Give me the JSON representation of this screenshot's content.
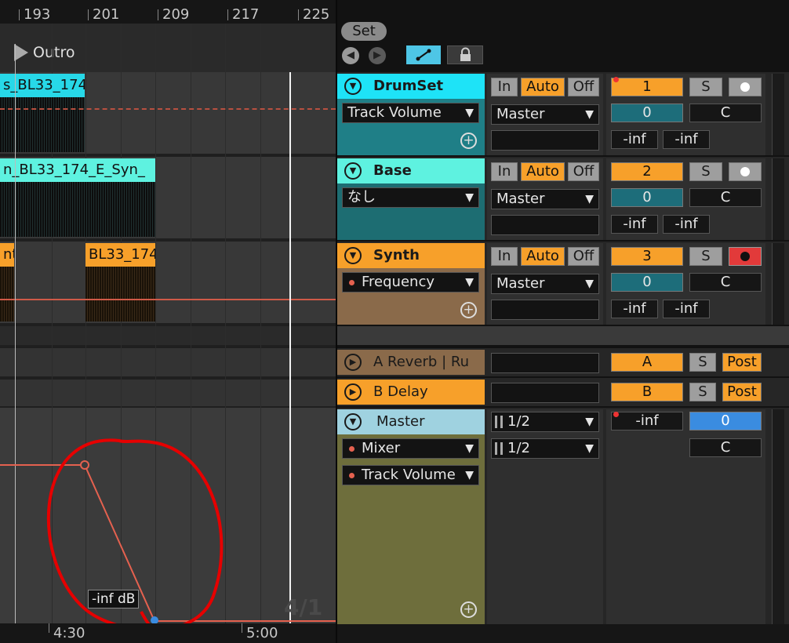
{
  "ruler": {
    "bars": [
      "193",
      "201",
      "209",
      "217",
      "225"
    ]
  },
  "locator": {
    "label": "Outro"
  },
  "clips": {
    "drum": "s_BL33_174",
    "base": "n_BL33_174_E_Syn_",
    "synth_a": "nt",
    "synth_b": "BL33_174"
  },
  "automation": {
    "tooltip": "-inf dB"
  },
  "time_sig": "4/1",
  "time_ruler": [
    "4:30",
    "5:00"
  ],
  "top_controls": {
    "set_label": "Set"
  },
  "tracks": [
    {
      "name": "DrumSet",
      "param": "Track Volume",
      "input": "In",
      "auto": "Auto",
      "off": "Off",
      "output": "Master",
      "number": "1",
      "solo": "S",
      "volume": "0",
      "pan": "C",
      "peak_l": "-inf",
      "peak_r": "-inf",
      "color": "#1ee3f7",
      "body": "#1f7f87"
    },
    {
      "name": "Base",
      "param": "なし",
      "input": "In",
      "auto": "Auto",
      "off": "Off",
      "output": "Master",
      "number": "2",
      "solo": "S",
      "volume": "0",
      "pan": "C",
      "peak_l": "-inf",
      "peak_r": "-inf",
      "color": "#5ef2e0",
      "body": "#1d6d72"
    },
    {
      "name": "Synth",
      "param": "Frequency",
      "input": "In",
      "auto": "Auto",
      "off": "Off",
      "output": "Master",
      "number": "3",
      "solo": "S",
      "volume": "0",
      "pan": "C",
      "peak_l": "-inf",
      "peak_r": "-inf",
      "color": "#f7a02a",
      "body": "#8a6a4a"
    }
  ],
  "returns": [
    {
      "name": "A Reverb | Ru",
      "letter": "A",
      "solo": "S",
      "post": "Post"
    },
    {
      "name": "B Delay",
      "letter": "B",
      "solo": "S",
      "post": "Post"
    }
  ],
  "master": {
    "name": "Master",
    "param1": "Mixer",
    "param2": "Track Volume",
    "out1": "1/2",
    "out2": "1/2",
    "peak": "-inf",
    "volume": "0",
    "pan": "C"
  }
}
